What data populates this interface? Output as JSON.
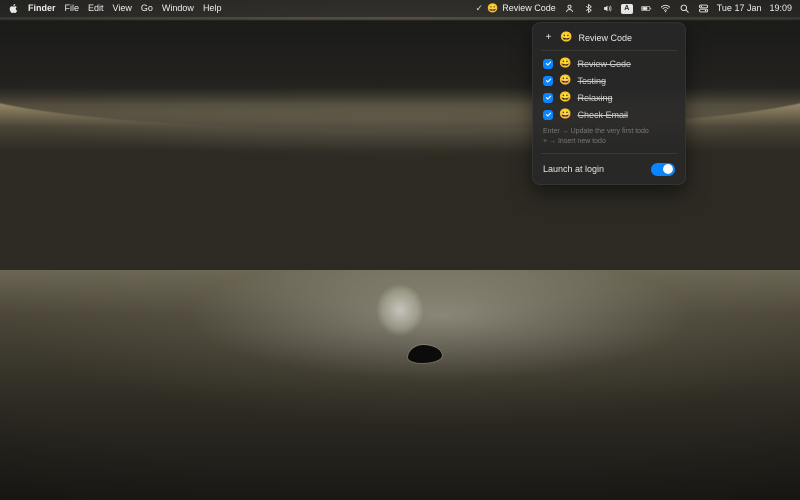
{
  "menubar": {
    "apple_icon": "apple-logo-icon",
    "app_name": "Finder",
    "menus": [
      "File",
      "Edit",
      "View",
      "Go",
      "Window",
      "Help"
    ],
    "status": {
      "todo_check": "✓",
      "todo_emoji": "😀",
      "todo_label": "Review Code",
      "input_source": "A",
      "date": "Tue 17 Jan",
      "time": "19:09"
    }
  },
  "todo_panel": {
    "header": {
      "add_icon": "+",
      "emoji": "😀",
      "title": "Review Code"
    },
    "tasks": [
      {
        "emoji": "😀",
        "label": "Review Code",
        "done": true
      },
      {
        "emoji": "😀",
        "label": "Testing",
        "done": true
      },
      {
        "emoji": "😀",
        "label": "Relaxing",
        "done": true
      },
      {
        "emoji": "😀",
        "label": "Check Email",
        "done": true
      }
    ],
    "hints": {
      "line1": "Enter → Update the very first todo",
      "line2": "+ → Insert new todo"
    },
    "footer": {
      "launch_label": "Launch at login",
      "launch_on": true
    }
  },
  "colors": {
    "accent": "#0a84ff"
  }
}
